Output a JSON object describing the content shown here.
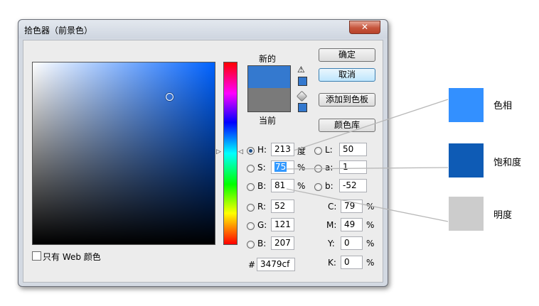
{
  "window": {
    "title": "拾色器（前景色）",
    "close": "✕"
  },
  "picker": {
    "new_label": "新的",
    "current_label": "当前",
    "web_only_label": "只有 Web 颜色",
    "new_color": "#3479cf",
    "current_color": "#7a7a7a"
  },
  "buttons": {
    "ok": "确定",
    "cancel": "取消",
    "add_swatch": "添加到色板",
    "libraries": "颜色库"
  },
  "hsb": [
    {
      "key": "H:",
      "value": "213",
      "unit": "度"
    },
    {
      "key": "S:",
      "value": "75",
      "unit": "%"
    },
    {
      "key": "B:",
      "value": "81",
      "unit": "%"
    }
  ],
  "lab": [
    {
      "key": "L:",
      "value": "50"
    },
    {
      "key": "a:",
      "value": "1"
    },
    {
      "key": "b:",
      "value": "-52"
    }
  ],
  "rgb": [
    {
      "key": "R:",
      "value": "52"
    },
    {
      "key": "G:",
      "value": "121"
    },
    {
      "key": "B:",
      "value": "207"
    }
  ],
  "cmyk": [
    {
      "key": "C:",
      "value": "79",
      "unit": "%"
    },
    {
      "key": "M:",
      "value": "49",
      "unit": "%"
    },
    {
      "key": "Y:",
      "value": "0",
      "unit": "%"
    },
    {
      "key": "K:",
      "value": "0",
      "unit": "%"
    }
  ],
  "hex": {
    "key": "#",
    "value": "3479cf"
  },
  "legend": [
    {
      "label": "色相",
      "color": "#3390ff"
    },
    {
      "label": "饱和度",
      "color": "#0e5bb5"
    },
    {
      "label": "明度",
      "color": "#cccccc"
    }
  ]
}
